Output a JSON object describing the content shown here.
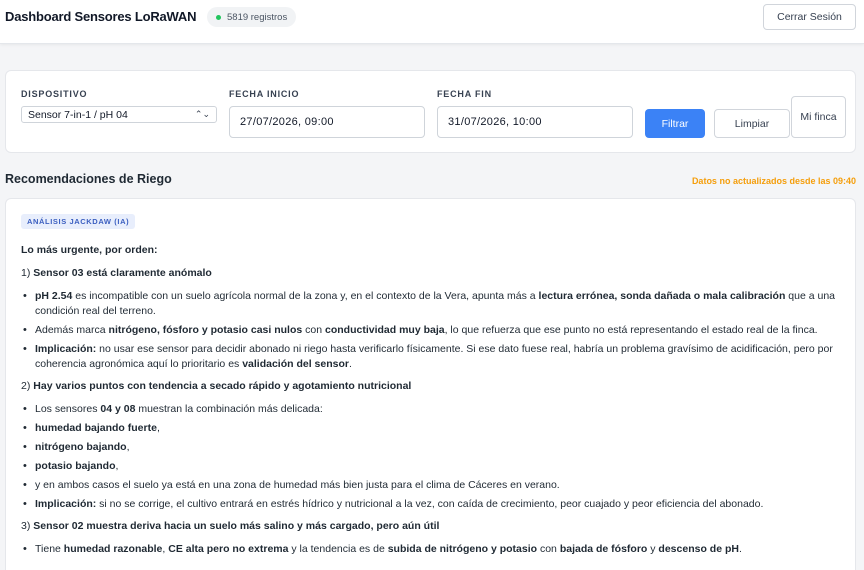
{
  "header": {
    "title": "Dashboard Sensores LoRaWAN",
    "records": "5819 registros",
    "logout_label": "Cerrar Sesión"
  },
  "filters": {
    "device_label": "DISPOSITIVO",
    "device_value": "Sensor 7-in-1 / pH 04",
    "start_label": "FECHA INICIO",
    "start_value": "27/07/2026, 09:00",
    "end_label": "FECHA FIN",
    "end_value": "31/07/2026, 10:00",
    "filter_button": "Filtrar",
    "clear_button": "Limpiar",
    "farm_button": "Mi finca"
  },
  "recommendations": {
    "title": "Recomendaciones de Riego",
    "stale_note": "Datos no actualizados desde las 09:40",
    "badge": "ANÁLISIS JACKDAW (IA)",
    "intro": "Lo más urgente, por orden:",
    "sections": [
      {
        "num": "1)",
        "heading": "Sensor 03 está claramente anómalo",
        "bullets": [
          [
            {
              "t": "pH 2.54",
              "b": true
            },
            {
              "t": " es incompatible con un suelo agrícola normal de la zona y, en el contexto de la Vera, apunta más a "
            },
            {
              "t": "lectura errónea, sonda dañada o mala calibración",
              "b": true
            },
            {
              "t": " que a una condición real del terreno."
            }
          ],
          [
            {
              "t": "Además marca "
            },
            {
              "t": "nitrógeno, fósforo y potasio casi nulos",
              "b": true
            },
            {
              "t": " con "
            },
            {
              "t": "conductividad muy baja",
              "b": true
            },
            {
              "t": ", lo que refuerza que ese punto no está representando el estado real de la finca."
            }
          ],
          [
            {
              "t": "Implicación:",
              "b": true
            },
            {
              "t": " no usar ese sensor para decidir abonado ni riego hasta verificarlo físicamente. Si ese dato fuese real, habría un problema gravísimo de acidificación, pero por coherencia agronómica aquí lo prioritario es "
            },
            {
              "t": "validación del sensor",
              "b": true
            },
            {
              "t": "."
            }
          ]
        ]
      },
      {
        "num": "2)",
        "heading": "Hay varios puntos con tendencia a secado rápido y agotamiento nutricional",
        "bullets": [
          [
            {
              "t": "Los sensores "
            },
            {
              "t": "04 y 08",
              "b": true
            },
            {
              "t": " muestran la combinación más delicada:"
            }
          ],
          [
            {
              "t": "humedad bajando fuerte",
              "b": true
            },
            {
              "t": ","
            }
          ],
          [
            {
              "t": "nitrógeno bajando",
              "b": true
            },
            {
              "t": ","
            }
          ],
          [
            {
              "t": "potasio bajando",
              "b": true
            },
            {
              "t": ","
            }
          ],
          [
            {
              "t": "y en ambos casos el suelo ya está en una zona de humedad más bien justa para el clima de Cáceres en verano."
            }
          ],
          [
            {
              "t": "Implicación:",
              "b": true
            },
            {
              "t": " si no se corrige, el cultivo entrará en estrés hídrico y nutricional a la vez, con caída de crecimiento, peor cuajado y peor eficiencia del abonado."
            }
          ]
        ]
      },
      {
        "num": "3)",
        "heading": "Sensor 02 muestra deriva hacia un suelo más salino y más cargado, pero aún útil",
        "bullets": [
          [
            {
              "t": "Tiene "
            },
            {
              "t": "humedad razonable",
              "b": true
            },
            {
              "t": ", "
            },
            {
              "t": "CE alta pero no extrema",
              "b": true
            },
            {
              "t": " y la tendencia es de "
            },
            {
              "t": "subida de nitrógeno y potasio",
              "b": true
            },
            {
              "t": " con "
            },
            {
              "t": "bajada de fósforo",
              "b": true
            },
            {
              "t": " y "
            },
            {
              "t": "descenso de pH",
              "b": true
            },
            {
              "t": "."
            }
          ]
        ]
      }
    ]
  },
  "colors": {
    "accent": "#3b82f6",
    "warning": "#f59e0b",
    "status_dot": "#22c55e",
    "badge_bg": "#e8eefc"
  }
}
